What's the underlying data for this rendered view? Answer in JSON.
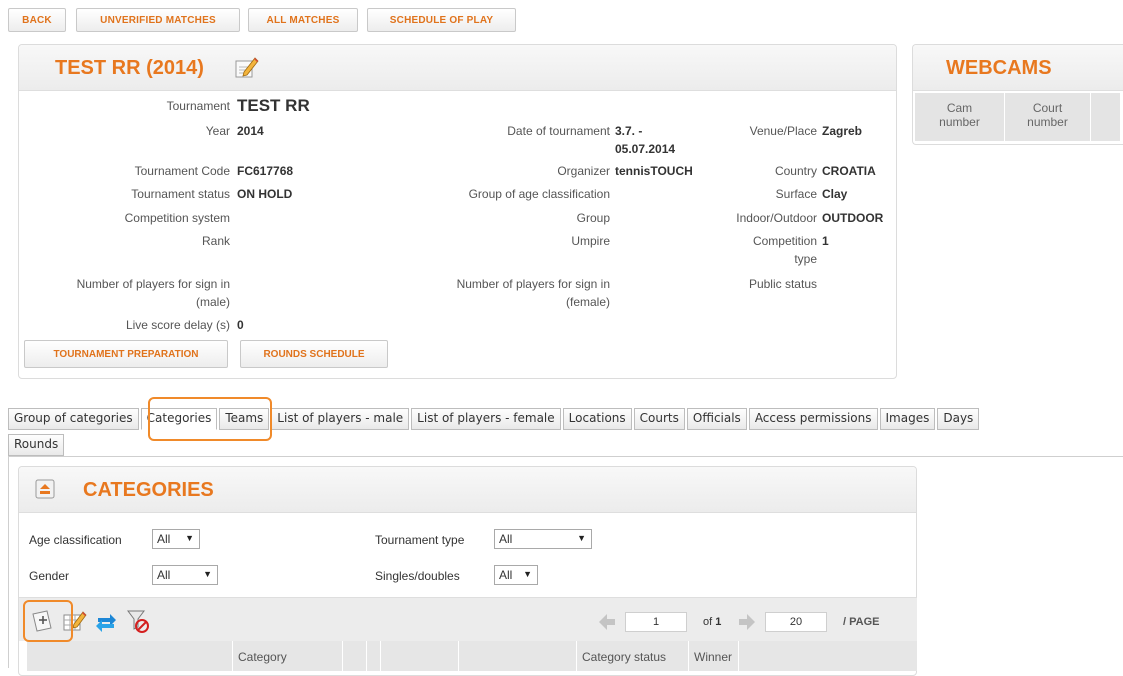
{
  "top_buttons": [
    "BACK",
    "UNVERIFIED MATCHES",
    "ALL MATCHES",
    "SCHEDULE OF PLAY"
  ],
  "tournament": {
    "title": "TEST RR (2014)",
    "fields": {
      "tournament_label": "Tournament",
      "tournament_value": "TEST RR",
      "year_label": "Year",
      "year_value": "2014",
      "date_label": "Date of tournament",
      "date_value_1": "3.7. -",
      "date_value_2": "05.07.2014",
      "venue_label": "Venue/Place",
      "venue_value": "Zagreb",
      "code_label": "Tournament Code",
      "code_value": "FC617768",
      "organizer_label": "Organizer",
      "organizer_value": "tennisTOUCH",
      "country_label": "Country",
      "country_value": "CROATIA",
      "status_label": "Tournament status",
      "status_value": "ON HOLD",
      "age_group_label": "Group of age classification",
      "surface_label": "Surface",
      "surface_value": "Clay",
      "competition_system_label": "Competition system",
      "group_label": "Group",
      "indoor_label": "Indoor/Outdoor",
      "indoor_value": "OUTDOOR",
      "rank_label": "Rank",
      "umpire_label": "Umpire",
      "competition_type_label_1": "Competition",
      "competition_type_label_2": "type",
      "competition_type_value": "1",
      "players_male_label_1": "Number of players for sign in",
      "players_male_label_2": "(male)",
      "players_female_label_1": "Number of players for sign in",
      "players_female_label_2": "(female)",
      "public_status_label": "Public status",
      "live_delay_label": "Live score delay (s)",
      "live_delay_value": "0"
    },
    "buttons": {
      "preparation": "TOURNAMENT PREPARATION",
      "rounds_schedule": "ROUNDS SCHEDULE"
    }
  },
  "webcams": {
    "title": "WEBCAMS",
    "columns": [
      [
        "Cam",
        "number"
      ],
      [
        "Court",
        "number"
      ]
    ]
  },
  "tabs": [
    "Group of categories",
    "Categories",
    "Teams",
    "List of players - male",
    "List of players - female",
    "Locations",
    "Courts",
    "Officials",
    "Access permissions",
    "Images",
    "Days"
  ],
  "tabs_row2": [
    "Rounds"
  ],
  "active_tab": "Categories",
  "categories": {
    "title": "CATEGORIES",
    "filters": {
      "age_label": "Age classification",
      "age_value": "All",
      "tournament_type_label": "Tournament type",
      "tournament_type_value": "All",
      "gender_label": "Gender",
      "gender_value": "All",
      "singles_label": "Singles/doubles",
      "singles_value": "All"
    },
    "pagination": {
      "page": "1",
      "of_label": "of",
      "total": "1",
      "per_page": "20",
      "page_label": "/ PAGE"
    },
    "table_headers": [
      "",
      "Category",
      "",
      "",
      "",
      "",
      "Category status",
      "Winner",
      ""
    ]
  },
  "colors": {
    "accent": "#e8781f",
    "highlight": "#f08a2a"
  },
  "icons": [
    "edit-icon",
    "collapse-icon",
    "add-category-icon",
    "edit-table-icon",
    "swap-icon",
    "clear-filter-icon",
    "prev-page-icon",
    "next-page-icon"
  ]
}
